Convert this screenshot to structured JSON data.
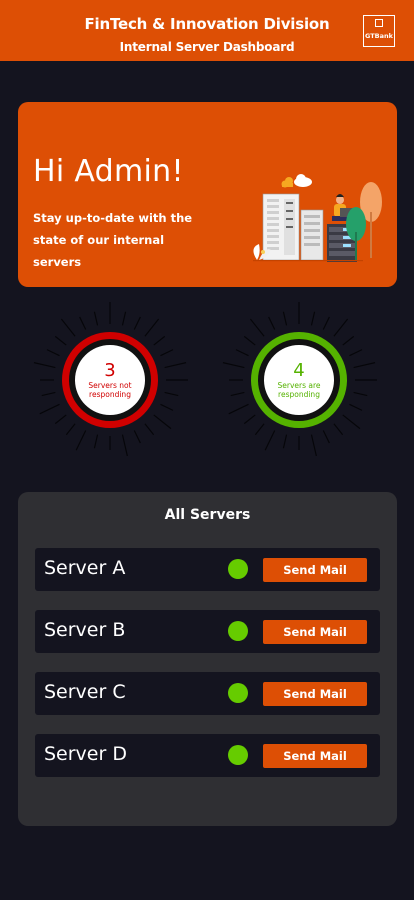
{
  "header": {
    "title": "FinTech & Innovation Division",
    "subtitle": "Internal Server Dashboard",
    "logo_text": "GTBank",
    "color": "#dd4f05"
  },
  "hero": {
    "greeting": "Hi Admin!",
    "description": "Stay up-to-date with the state of our internal servers",
    "illustration": "server-room-illustration"
  },
  "stats": {
    "not_responding": {
      "count": "3",
      "label": "Servers not responding",
      "color": "#d00000"
    },
    "responding": {
      "count": "4",
      "label": "Servers are responding",
      "color": "#55b200"
    }
  },
  "servers": {
    "heading": "All Servers",
    "items": [
      {
        "name": "Server A",
        "status_color": "#66cc00",
        "action": "Send Mail"
      },
      {
        "name": "Server B",
        "status_color": "#66cc00",
        "action": "Send Mail"
      },
      {
        "name": "Server C",
        "status_color": "#66cc00",
        "action": "Send Mail"
      },
      {
        "name": "Server D",
        "status_color": "#66cc00",
        "action": "Send Mail"
      }
    ]
  }
}
